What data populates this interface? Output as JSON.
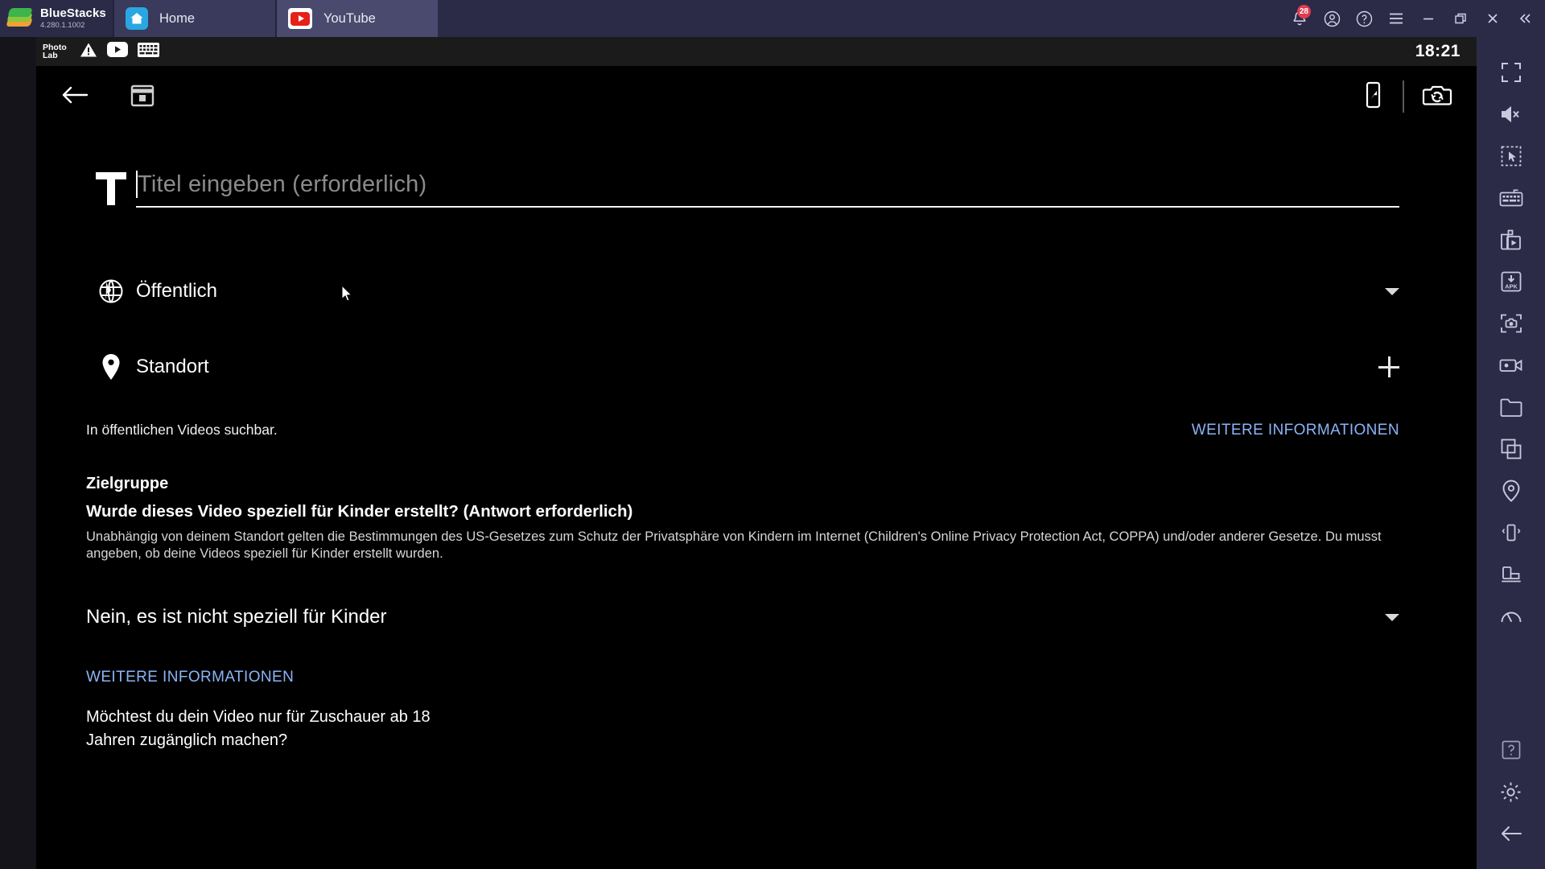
{
  "window": {
    "brand": "BlueStacks",
    "version": "4.280.1.1002",
    "tabs": [
      {
        "label": "Home",
        "icon": "home-icon",
        "active": false
      },
      {
        "label": "YouTube",
        "icon": "youtube-icon",
        "active": true
      }
    ],
    "controls": [
      {
        "name": "notifications-button",
        "icon": "bell-icon",
        "badge": "28"
      },
      {
        "name": "account-button",
        "icon": "account-icon",
        "badge": ""
      },
      {
        "name": "help-button",
        "icon": "help-icon",
        "badge": ""
      },
      {
        "name": "menu-button",
        "icon": "hamburger-icon",
        "badge": ""
      },
      {
        "name": "minimize-button",
        "icon": "minimize-icon",
        "badge": ""
      },
      {
        "name": "maximize-button",
        "icon": "maximize-icon",
        "badge": ""
      },
      {
        "name": "close-button",
        "icon": "close-icon",
        "badge": ""
      },
      {
        "name": "collapse-sidebar-button",
        "icon": "double-chevron-left-icon",
        "badge": ""
      }
    ]
  },
  "statusbar": {
    "app_badge": "Photo Lab",
    "icons": [
      "warning-icon",
      "youtube-icon",
      "keyboard-icon"
    ],
    "time": "18:21"
  },
  "appbar": {
    "back": "back-arrow-icon",
    "schedule": "calendar-icon",
    "cast": "cast-to-phone-icon",
    "switch_camera": "camera-flip-icon"
  },
  "form": {
    "title_icon": "title-T-icon",
    "title_placeholder": "Titel eingeben (erforderlich)",
    "title_value": "",
    "visibility": {
      "icon": "globe-icon",
      "label": "Öffentlich",
      "control": "chevron-down-icon"
    },
    "location": {
      "icon": "location-pin-icon",
      "label": "Standort",
      "control": "plus-icon"
    },
    "searchable_note": "In öffentlichen Videos suchbar.",
    "searchable_link": "WEITERE INFORMATIONEN"
  },
  "audience": {
    "heading": "Zielgruppe",
    "question": "Wurde dieses Video speziell für Kinder erstellt? (Antwort erforderlich)",
    "body": "Unabhängig von deinem Standort gelten die Bestimmungen des US-Gesetzes zum Schutz der Privatsphäre von Kindern im Internet (Children's Online Privacy Protection Act, COPPA) und/oder anderer Gesetze. Du musst angeben, ob deine Videos speziell für Kinder erstellt wurden.",
    "answer": "Nein, es ist nicht speziell für Kinder",
    "answer_control": "chevron-down-icon",
    "more_info_link": "WEITERE INFORMATIONEN",
    "age_question": "Möchtest du dein Video nur für Zuschauer ab 18\nJahren zugänglich machen?"
  },
  "sidebar": {
    "items": [
      {
        "name": "fullscreen-button",
        "icon": "fullscreen-icon"
      },
      {
        "name": "mute-button",
        "icon": "speaker-mute-icon"
      },
      {
        "name": "game-controls-button",
        "icon": "cursor-select-icon"
      },
      {
        "name": "keymapping-button",
        "icon": "keyboard-icon"
      },
      {
        "name": "media-manager-button",
        "icon": "media-play-icon"
      },
      {
        "name": "install-apk-button",
        "icon": "apk-download-icon"
      },
      {
        "name": "screenshot-button",
        "icon": "camera-screenshot-icon"
      },
      {
        "name": "record-screen-button",
        "icon": "video-camera-icon"
      },
      {
        "name": "media-folder-button",
        "icon": "folder-icon"
      },
      {
        "name": "multi-instance-button",
        "icon": "copy-windows-icon"
      },
      {
        "name": "location-button",
        "icon": "location-pin-icon"
      },
      {
        "name": "shake-button",
        "icon": "shake-phone-icon"
      },
      {
        "name": "rotate-button",
        "icon": "rotate-screen-icon"
      },
      {
        "name": "performance-button",
        "icon": "gauge-icon"
      }
    ],
    "bottom_items": [
      {
        "name": "help-button",
        "icon": "question-box-icon"
      },
      {
        "name": "settings-button",
        "icon": "gear-icon"
      },
      {
        "name": "back-button",
        "icon": "back-arrow-icon"
      }
    ]
  },
  "colors": {
    "titlebar": "#2b2b48",
    "tab_active": "#4a4a6e",
    "link": "#8ab4f8",
    "badge": "#e23b4e",
    "youtube_red": "#e62117"
  }
}
